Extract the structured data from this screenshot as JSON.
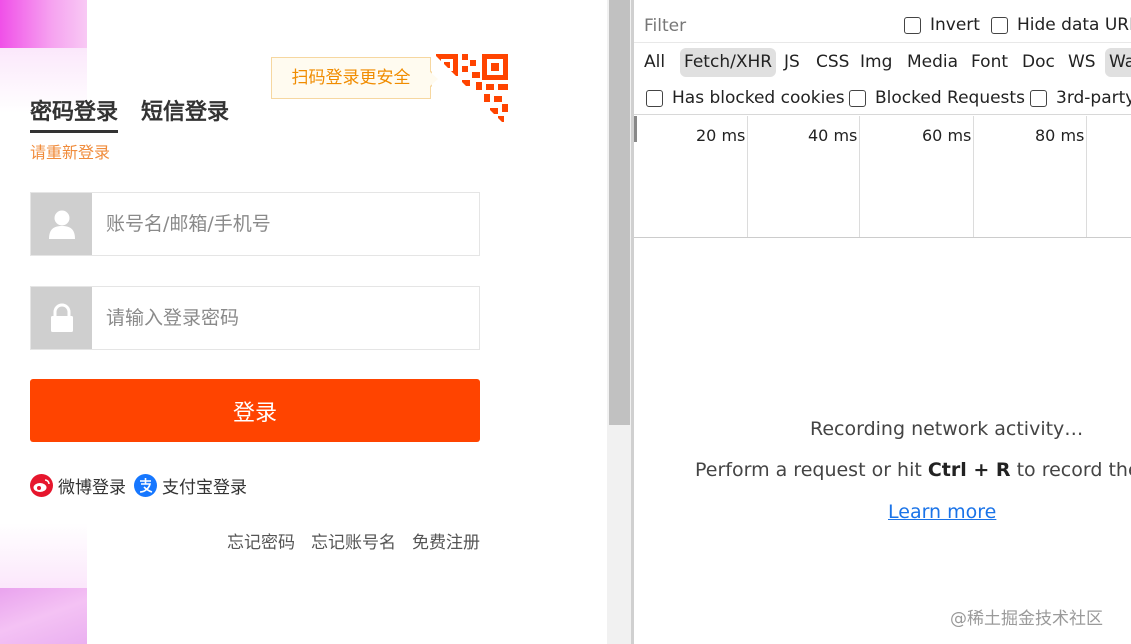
{
  "login": {
    "qr_tip": "扫码登录更安全",
    "tabs": [
      {
        "label": "密码登录",
        "active": true
      },
      {
        "label": "短信登录",
        "active": false
      }
    ],
    "relogin_hint": "请重新登录",
    "username_placeholder": "账号名/邮箱/手机号",
    "password_placeholder": "请输入登录密码",
    "submit_label": "登录",
    "third_party": [
      {
        "label": "微博登录",
        "icon": "weibo-icon"
      },
      {
        "label": "支付宝登录",
        "icon": "alipay-icon"
      }
    ],
    "links": [
      "忘记密码",
      "忘记账号名",
      "免费注册"
    ],
    "colors": {
      "accent": "#ff4400",
      "hint": "#f08c3c",
      "qr": "#ff4400"
    }
  },
  "devtools": {
    "filter_placeholder": "Filter",
    "invert_label": "Invert",
    "hide_data_urls_label": "Hide data URL",
    "type_filters": [
      "All",
      "Fetch/XHR",
      "JS",
      "CSS",
      "Img",
      "Media",
      "Font",
      "Doc",
      "WS",
      "Wa"
    ],
    "selected_type_filters": [
      "Fetch/XHR",
      "Wa"
    ],
    "row3_checkboxes": [
      "Has blocked cookies",
      "Blocked Requests",
      "3rd-party"
    ],
    "timeline_ticks": [
      "20 ms",
      "40 ms",
      "60 ms",
      "80 ms"
    ],
    "empty_state": {
      "recording": "Recording network activity…",
      "perform_prefix": "Perform a request or hit ",
      "shortcut": "Ctrl + R",
      "perform_suffix": " to record the r",
      "learn_more": "Learn more"
    }
  },
  "watermark": "@稀土掘金技术社区"
}
